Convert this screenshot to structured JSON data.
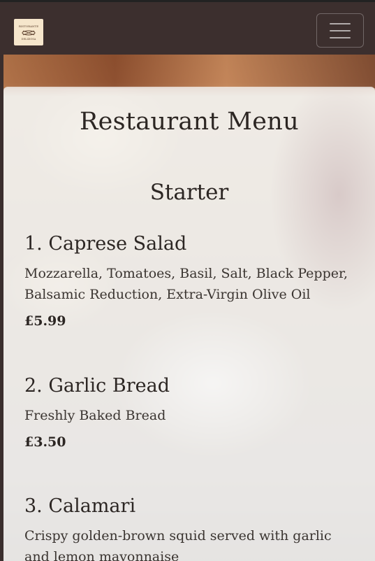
{
  "brand": {
    "logo_alt": "Ristorante Deliziosa logo",
    "logo_top_text": "RISTORANTE",
    "logo_bottom_text": "DELIZIOSA"
  },
  "nav": {
    "toggler_icon": "hamburger-menu-icon"
  },
  "menu": {
    "title": "Restaurant Menu",
    "sections": [
      {
        "title": "Starter",
        "items": [
          {
            "name": "1. Caprese Salad",
            "description": "Mozzarella, Tomatoes, Basil, Salt, Black Pepper, Balsamic Reduction, Extra-Virgin Olive Oil",
            "price": "£5.99"
          },
          {
            "name": "2. Garlic Bread",
            "description": "Freshly Baked Bread",
            "price": "£3.50"
          },
          {
            "name": "3. Calamari",
            "description": "Crispy golden-brown squid served with garlic and lemon mayonnaise",
            "price": ""
          }
        ]
      }
    ]
  },
  "colors": {
    "navbar": "#3c2f2e",
    "card_bg": "rgba(245,244,242,0.80)",
    "text": "#2c2623"
  }
}
